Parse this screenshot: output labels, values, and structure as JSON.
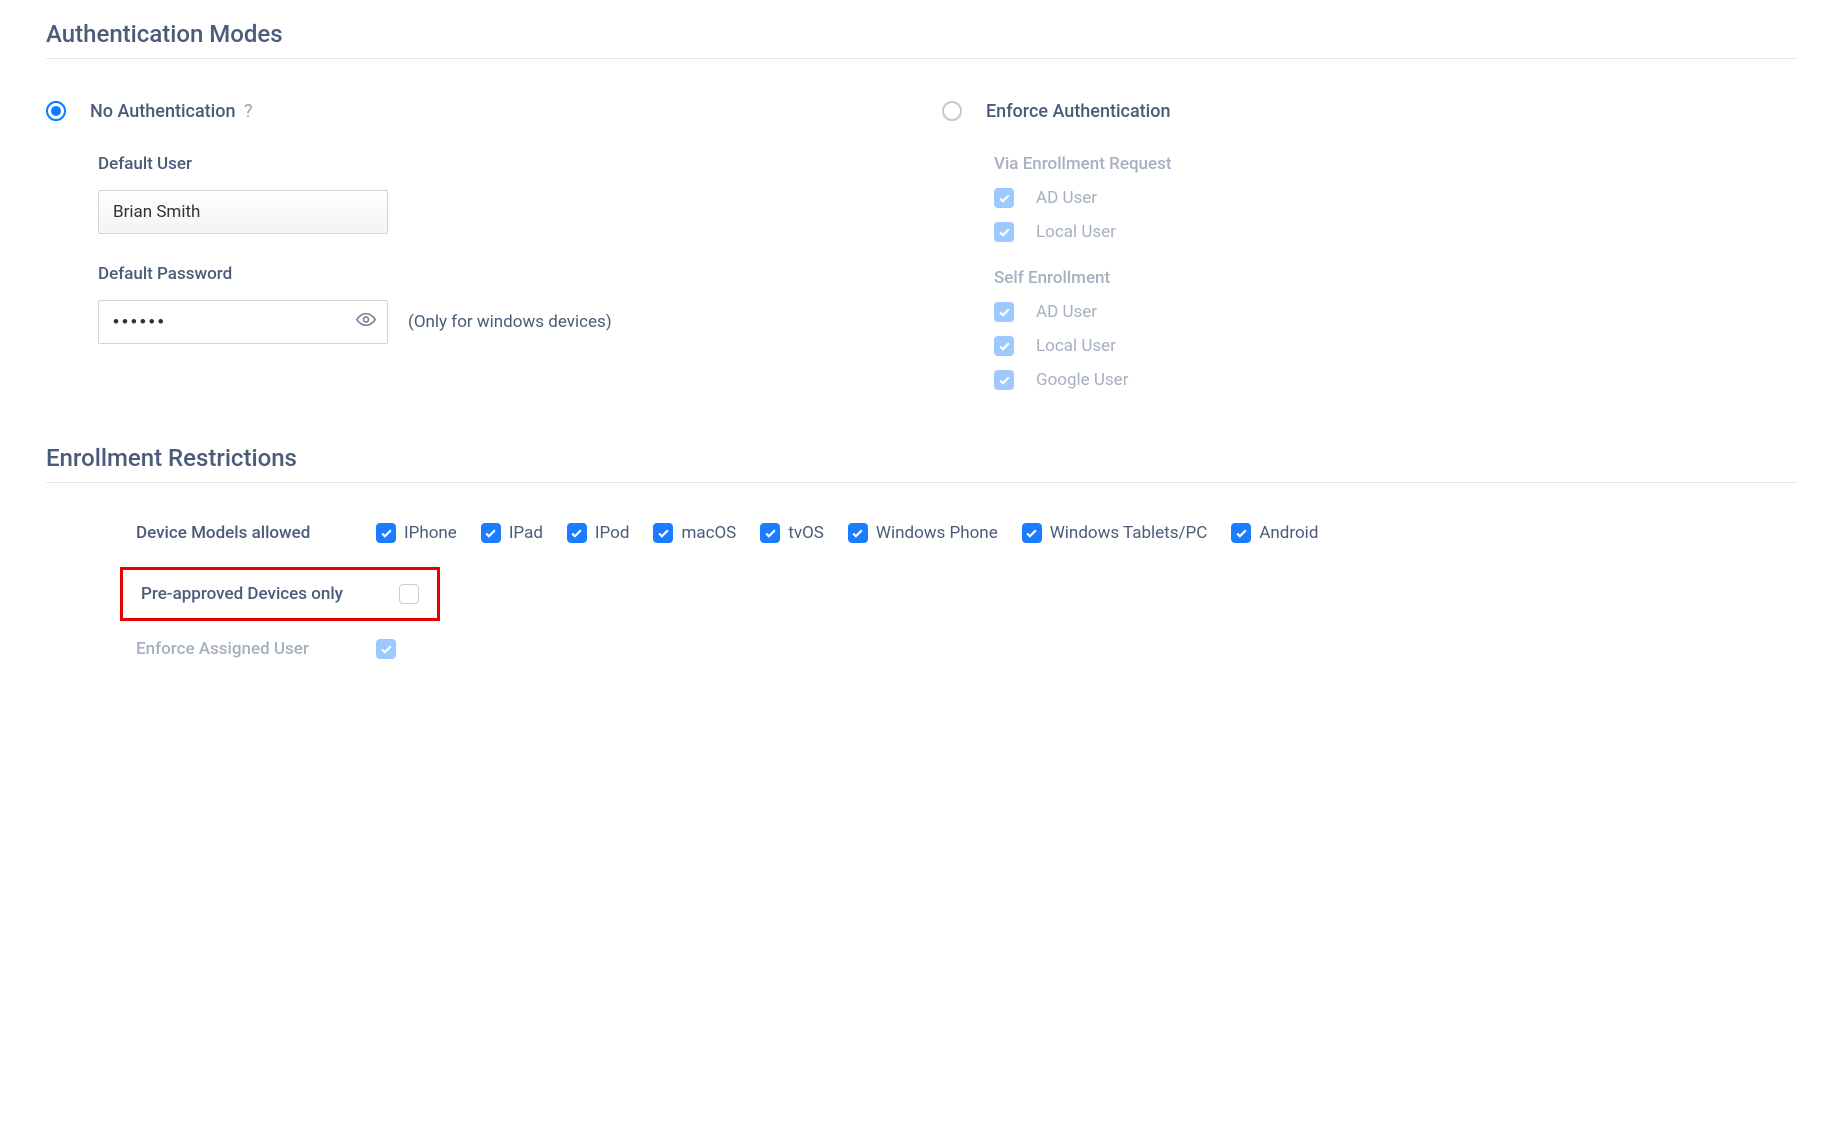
{
  "sections": {
    "auth_title": "Authentication Modes",
    "restrict_title": "Enrollment Restrictions"
  },
  "auth": {
    "no_auth_label": "No Authentication",
    "help_symbol": "?",
    "enforce_label": "Enforce Authentication",
    "default_user_label": "Default User",
    "default_user_value": "Brian Smith",
    "default_password_label": "Default Password",
    "default_password_value": "••••••",
    "password_hint": "(Only for windows devices)",
    "via_enrollment_label": "Via Enrollment Request",
    "self_enrollment_label": "Self Enrollment",
    "via_items": [
      {
        "label": "AD User"
      },
      {
        "label": "Local User"
      }
    ],
    "self_items": [
      {
        "label": "AD User"
      },
      {
        "label": "Local User"
      },
      {
        "label": "Google User"
      }
    ]
  },
  "restrict": {
    "device_models_label": "Device Models allowed",
    "devices": [
      {
        "label": "IPhone"
      },
      {
        "label": "IPad"
      },
      {
        "label": "IPod"
      },
      {
        "label": "macOS"
      },
      {
        "label": "tvOS"
      },
      {
        "label": "Windows Phone"
      },
      {
        "label": "Windows Tablets/PC"
      },
      {
        "label": "Android"
      }
    ],
    "preapproved_label": "Pre-approved Devices only",
    "enforce_assigned_label": "Enforce Assigned User"
  }
}
